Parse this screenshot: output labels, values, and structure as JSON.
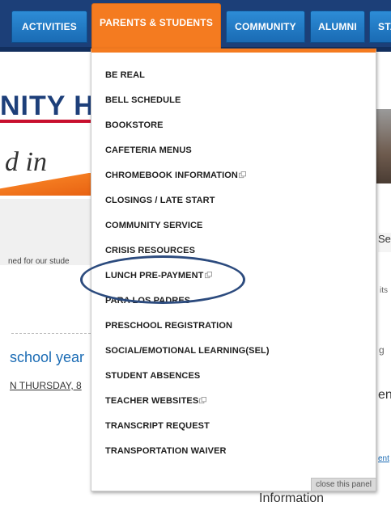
{
  "nav": {
    "tabs": [
      {
        "label": "ACTIVITIES"
      },
      {
        "label": "PARENTS & STUDENTS"
      },
      {
        "label": "COMMUNITY"
      },
      {
        "label": "ALUMNI"
      },
      {
        "label": "STA"
      }
    ]
  },
  "background": {
    "logo_text": "NITY HI",
    "script_text": "d in",
    "snippet": "ned for our stude",
    "school_year": "school year",
    "on_thursday": "N THURSDAY, 8",
    "right_se": "Se",
    "right_its": "its",
    "right_g": "g",
    "right_en": "en",
    "right_ent": "ent",
    "information": "Information"
  },
  "dropdown": {
    "items": [
      {
        "label": "BE REAL"
      },
      {
        "label": "BELL SCHEDULE"
      },
      {
        "label": "BOOKSTORE"
      },
      {
        "label": "CAFETERIA MENUS"
      },
      {
        "label": "CHROMEBOOK INFORMATION"
      },
      {
        "label": "CLOSINGS / LATE START"
      },
      {
        "label": "COMMUNITY SERVICE"
      },
      {
        "label": "CRISIS RESOURCES"
      },
      {
        "label": "LUNCH PRE-PAYMENT"
      },
      {
        "label": "PARA LOS PADRES"
      },
      {
        "label": "PRESCHOOL REGISTRATION"
      },
      {
        "label": "SOCIAL/EMOTIONAL LEARNING(SEL)"
      },
      {
        "label": "STUDENT ABSENCES"
      },
      {
        "label": "TEACHER WEBSITES"
      },
      {
        "label": "TRANSCRIPT REQUEST"
      },
      {
        "label": "TRANSPORTATION WAIVER"
      }
    ],
    "close_label": "close this panel"
  },
  "colors": {
    "nav_bg": "#1c3f78",
    "tab_blue": "#2d8cd6",
    "tab_active": "#f47b20",
    "annotation_ellipse": "#2c4b7e"
  }
}
